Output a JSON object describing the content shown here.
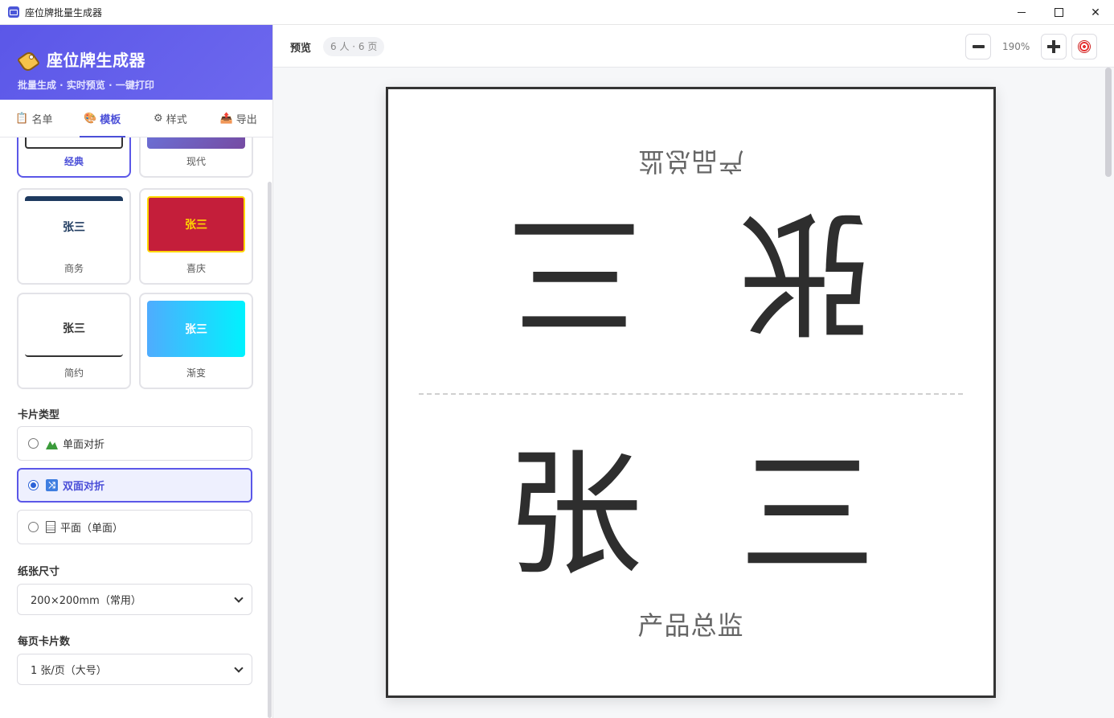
{
  "window": {
    "title": "座位牌批量生成器"
  },
  "sidebar": {
    "title": "座位牌生成器",
    "subtitle": "批量生成 · 实时预览 · 一键打印",
    "tabs": [
      {
        "label": "名单",
        "icon": "clipboard-icon",
        "active": false
      },
      {
        "label": "模板",
        "icon": "palette-icon",
        "active": true
      },
      {
        "label": "样式",
        "icon": "gear-icon",
        "active": false
      },
      {
        "label": "导出",
        "icon": "export-icon",
        "active": false
      }
    ],
    "templates": [
      {
        "label": "经典",
        "preview_text": "",
        "selected": true
      },
      {
        "label": "现代",
        "preview_text": "",
        "selected": false
      },
      {
        "label": "商务",
        "preview_text": "张三",
        "selected": false
      },
      {
        "label": "喜庆",
        "preview_text": "张三",
        "selected": false
      },
      {
        "label": "简约",
        "preview_text": "张三",
        "selected": false
      },
      {
        "label": "渐变",
        "preview_text": "张三",
        "selected": false
      }
    ],
    "card_type": {
      "label": "卡片类型",
      "options": [
        {
          "label": "单面对折",
          "selected": false
        },
        {
          "label": "双面对折",
          "selected": true
        },
        {
          "label": "平面（单面）",
          "selected": false
        }
      ]
    },
    "paper_size": {
      "label": "纸张尺寸",
      "value": "200×200mm（常用）"
    },
    "cards_per_page": {
      "label": "每页卡片数",
      "value": "1 张/页（大号）"
    }
  },
  "toolbar": {
    "preview_label": "预览",
    "count_badge": "6 人 · 6 页",
    "zoom": "190%"
  },
  "preview": {
    "name": "张三",
    "title": "产品总监"
  },
  "colors": {
    "accent": "#5b57e8",
    "festive_red": "#c41e3a",
    "festive_gold": "#ffd700"
  }
}
